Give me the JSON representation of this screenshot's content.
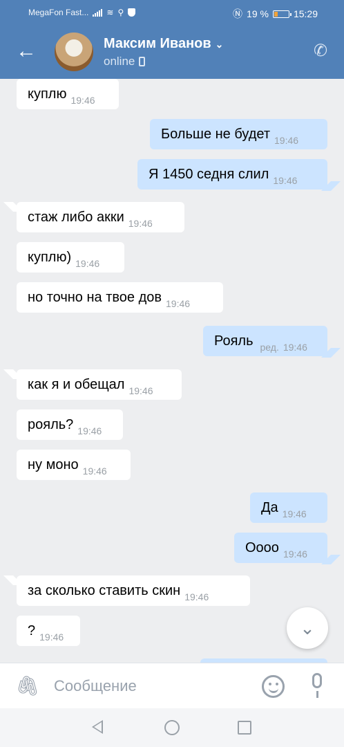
{
  "status_bar": {
    "carrier": "MegaFon Fast...",
    "battery": "19 %",
    "time": "15:29"
  },
  "header": {
    "contact_name": "Максим Иванов",
    "presence": "online"
  },
  "messages": [
    {
      "dir": "in",
      "text": "куплю",
      "time": "19:46"
    },
    {
      "dir": "out",
      "text": "Больше не будет",
      "time": "19:46"
    },
    {
      "dir": "out",
      "text": "Я 1450 седня слил",
      "time": "19:46"
    },
    {
      "dir": "in",
      "text": "стаж либо акки",
      "time": "19:46"
    },
    {
      "dir": "in",
      "text": "куплю)",
      "time": "19:46"
    },
    {
      "dir": "in",
      "text": "но точно на твое дов",
      "time": "19:46"
    },
    {
      "dir": "out",
      "text": "Рояль",
      "edited": "ред.",
      "time": "19:46"
    },
    {
      "dir": "in",
      "text": "как я и обещал",
      "time": "19:46"
    },
    {
      "dir": "in",
      "text": "рояль?",
      "time": "19:46"
    },
    {
      "dir": "in",
      "text": "ну моно",
      "time": "19:46"
    },
    {
      "dir": "out",
      "text": "Да",
      "time": "19:46"
    },
    {
      "dir": "out",
      "text": "Оооо",
      "time": "19:46"
    },
    {
      "dir": "in",
      "text": "за сколько ставить скин",
      "time": "19:46"
    },
    {
      "dir": "in",
      "text": "?",
      "time": "19:46"
    }
  ],
  "composer": {
    "placeholder": "Сообщение",
    "value": ""
  },
  "colors": {
    "header_bg": "#5181b8",
    "chat_bg": "#edeef0",
    "incoming_bubble": "#ffffff",
    "outgoing_bubble": "#cce4ff",
    "timestamp": "#9aa0a6"
  },
  "icons": {
    "back": "arrow-left-icon",
    "call": "phone-icon",
    "attach": "paperclip-icon",
    "emoji": "smile-icon",
    "voice": "microphone-icon",
    "scroll": "chevron-down-icon"
  }
}
